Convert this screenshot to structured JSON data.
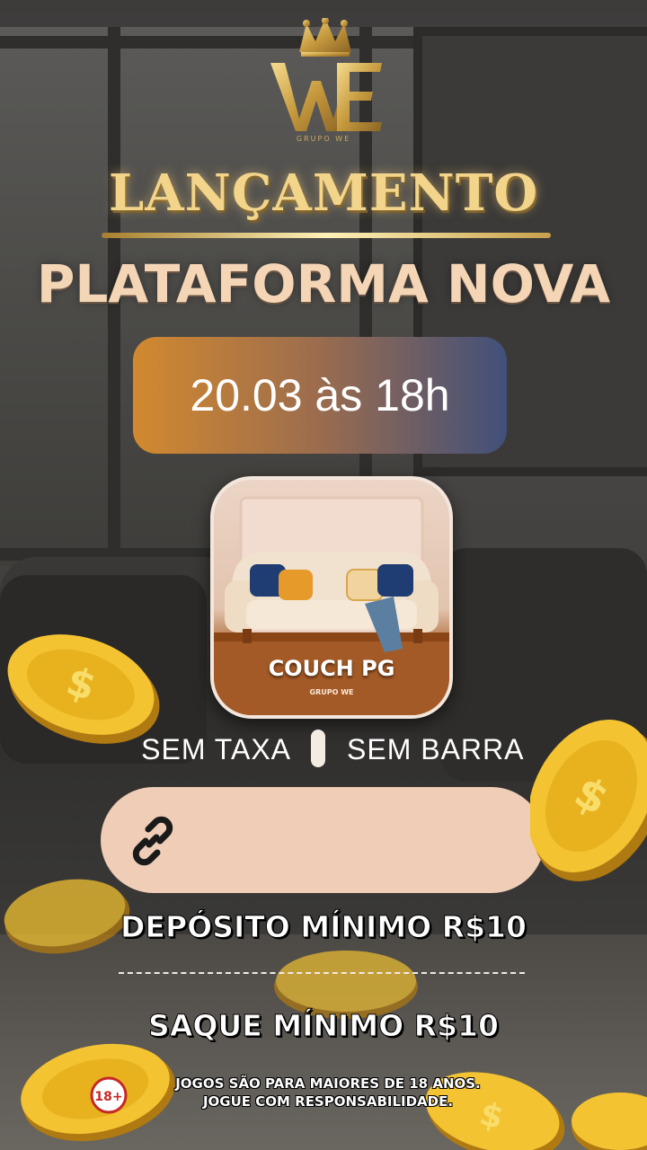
{
  "brand": {
    "logo_text": "WE",
    "logo_subtitle": "GRUPO WE"
  },
  "headline": "LANÇAMENTO",
  "subheadline": "PLATAFORMA NOVA",
  "launch_date": "20.03 às 18h",
  "app": {
    "name": "COUCH PG",
    "subtitle": "GRUPO WE"
  },
  "features": [
    "SEM TAXA",
    "SEM BARRA"
  ],
  "link_icon": "link-icon",
  "deposit_text": "DEPÓSITO MÍNIMO R$10",
  "withdraw_text": "SAQUE MÍNIMO R$10",
  "age_badge": "18+",
  "disclaimer_lines": [
    "JOGOS SÃO PARA MAIORES DE 18 ANOS.",
    "JOGUE COM RESPONSABILIDADE."
  ],
  "colors": {
    "gold": "#f2d58a",
    "peach": "#f4d5b6",
    "pill_left": "#d2892f",
    "pill_right": "#41507a",
    "link_bar": "#efcdb6"
  }
}
